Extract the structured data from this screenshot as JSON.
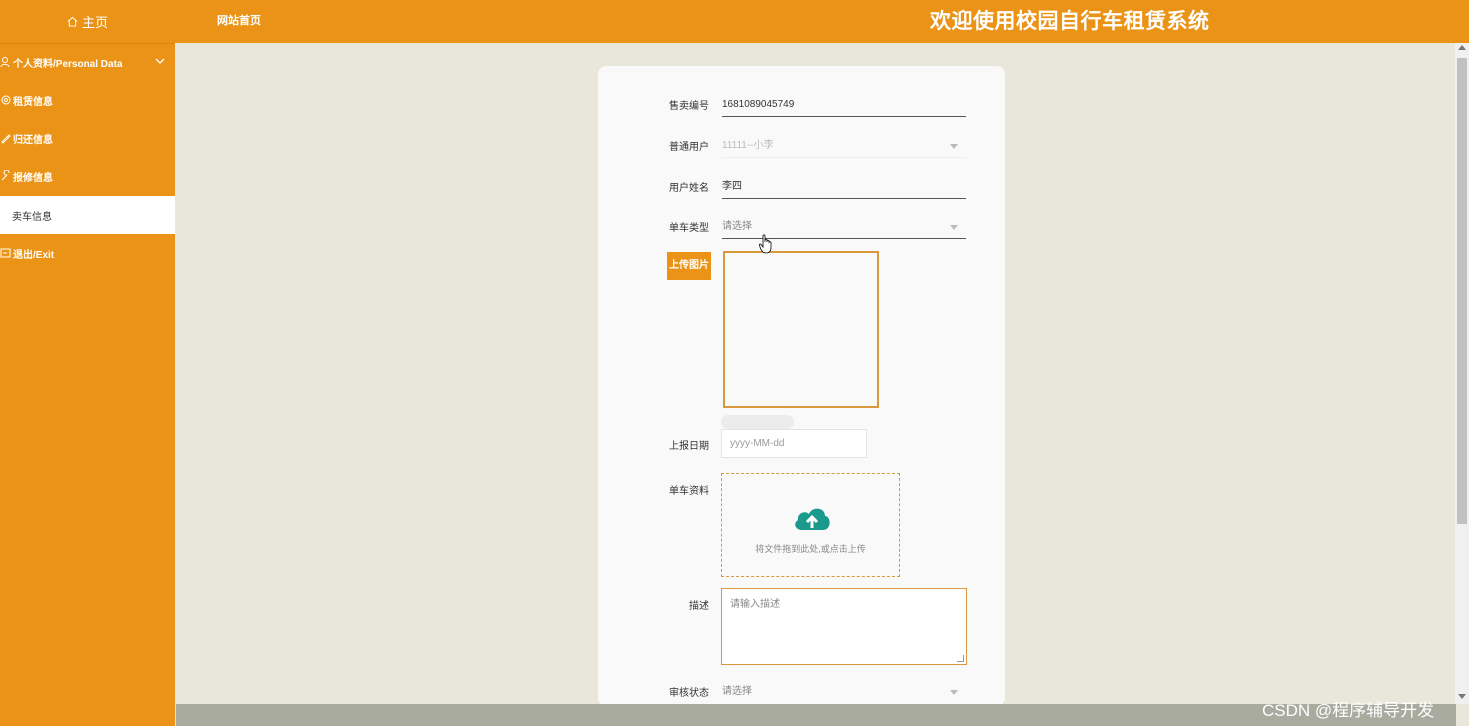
{
  "header": {
    "home_label": "主页",
    "site_link": "网站首页",
    "welcome": "欢迎使用校园自行车租赁系统"
  },
  "sidebar": {
    "items": [
      {
        "label": "个人资料/Personal Data",
        "icon": "person-icon"
      },
      {
        "label": "租赁信息",
        "icon": "gear-icon"
      },
      {
        "label": "归还信息",
        "icon": "pen-icon"
      },
      {
        "label": "报修信息",
        "icon": "wrench-icon"
      },
      {
        "label": "卖车信息",
        "icon": "none",
        "active": true
      },
      {
        "label": "退出/Exit",
        "icon": "exit-icon"
      }
    ]
  },
  "form": {
    "sale_no": {
      "label": "售卖编号",
      "value": "1681089045749"
    },
    "user": {
      "label": "普通用户",
      "value": "11111--小李"
    },
    "user_name": {
      "label": "用户姓名",
      "value": "李四"
    },
    "bike_type": {
      "label": "单车类型",
      "placeholder": "请选择"
    },
    "upload_button": "上传图片",
    "report_date": {
      "label": "上报日期",
      "placeholder": "yyyy-MM-dd"
    },
    "bike_doc": {
      "label": "单车资料",
      "drop_text": "将文件拖到此处,或点击上传"
    },
    "description": {
      "label": "描述",
      "placeholder": "请输入描述"
    },
    "audit_status": {
      "label": "审核状态",
      "placeholder": "请选择"
    }
  },
  "watermark": "CSDN @程序辅导开发",
  "colors": {
    "primary": "#ea9316",
    "background": "#e9e6db",
    "card": "#f9f9f9",
    "cloud": "#1a9a8c"
  }
}
